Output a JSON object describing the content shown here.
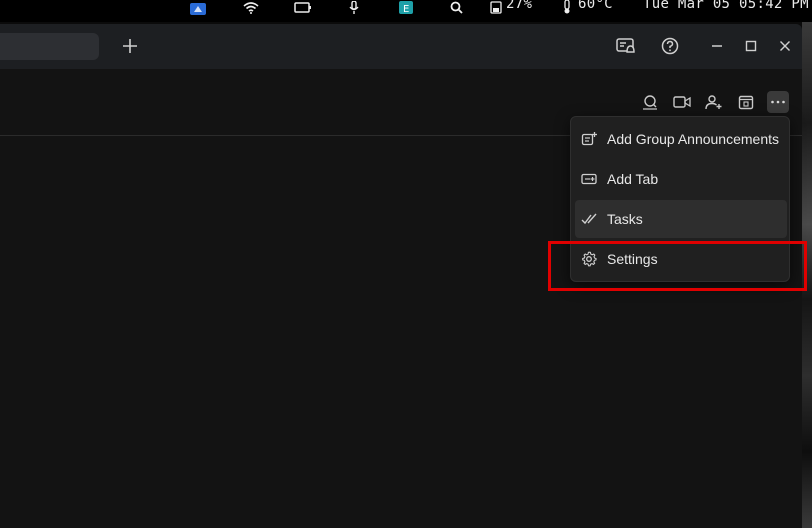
{
  "system_bar": {
    "battery": "27%",
    "temperature": "60°C",
    "clock": "Tue Mar 05 05:42 PM",
    "icons": [
      "app-badge-icon",
      "wifi-icon",
      "screen-share-icon",
      "microphone-icon",
      "e-app-icon",
      "search-icon",
      "battery-icon",
      "thermometer-icon"
    ]
  },
  "titlebar": {
    "icons": [
      "new-tab-plus-icon",
      "notifications-bell-icon",
      "help-icon",
      "minimize-icon",
      "maximize-icon",
      "close-icon"
    ]
  },
  "toolbar": {
    "icons": [
      "search-chat-icon",
      "video-call-icon",
      "add-member-icon",
      "calendar-icon",
      "more-options-icon"
    ]
  },
  "menu": {
    "items": [
      {
        "label": "Add Group Announcements",
        "icon": "announcement-icon"
      },
      {
        "label": "Add Tab",
        "icon": "add-tab-icon"
      },
      {
        "label": "Tasks",
        "icon": "tasks-check-icon"
      },
      {
        "label": "Settings",
        "icon": "settings-gear-icon"
      }
    ],
    "hovered_index": 2,
    "highlighted_index": 3,
    "highlight_color": "#e00000"
  },
  "colors": {
    "window_bg": "#131313",
    "titlebar_bg": "#1d1f22",
    "menu_bg": "#202020"
  }
}
